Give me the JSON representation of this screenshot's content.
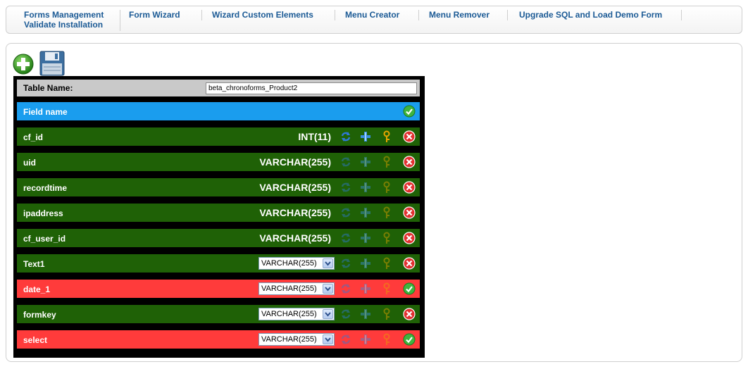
{
  "nav": {
    "forms_management": "Forms Management",
    "validate_installation": "Validate Installation",
    "form_wizard": "Form Wizard",
    "wizard_custom_elements": "Wizard Custom Elements",
    "menu_creator": "Menu Creator",
    "menu_remover": "Menu Remover",
    "upgrade_sql": "Upgrade SQL and Load Demo Form"
  },
  "toolbar": {
    "add_icon": "plus-circle-icon",
    "save_icon": "floppy-disk-icon"
  },
  "table": {
    "name_label": "Table Name:",
    "name_value": "beta_chronoforms_Product2",
    "header_label": "Field name",
    "fields": [
      {
        "name": "cf_id",
        "type": "INT(11)",
        "editable": false,
        "status": "remove"
      },
      {
        "name": "uid",
        "type": "VARCHAR(255)",
        "editable": false,
        "status": "remove"
      },
      {
        "name": "recordtime",
        "type": "VARCHAR(255)",
        "editable": false,
        "status": "remove"
      },
      {
        "name": "ipaddress",
        "type": "VARCHAR(255)",
        "editable": false,
        "status": "remove"
      },
      {
        "name": "cf_user_id",
        "type": "VARCHAR(255)",
        "editable": false,
        "status": "remove"
      },
      {
        "name": "Text1",
        "type": "VARCHAR(255)",
        "editable": true,
        "status": "remove"
      },
      {
        "name": "date_1",
        "type": "VARCHAR(255)",
        "editable": true,
        "status": "ok"
      },
      {
        "name": "formkey",
        "type": "VARCHAR(255)",
        "editable": true,
        "status": "remove"
      },
      {
        "name": "select",
        "type": "VARCHAR(255)",
        "editable": true,
        "status": "ok"
      }
    ]
  },
  "colors": {
    "row_existing": "#1f6106",
    "row_new": "#ff3b3b",
    "row_header": "#1a9dee",
    "link": "#1b5a95"
  }
}
